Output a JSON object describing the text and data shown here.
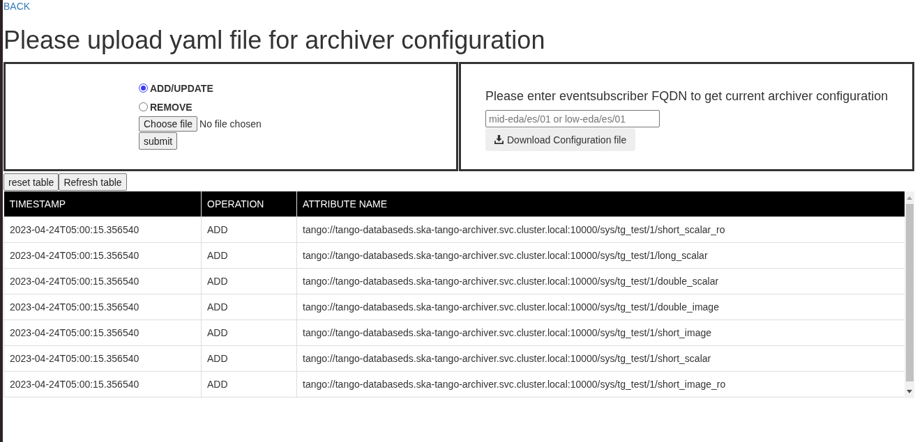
{
  "back_link": "BACK",
  "heading": "Please upload yaml file for archiver configuration",
  "upload_panel": {
    "operations": [
      {
        "label": "ADD/UPDATE",
        "selected": true
      },
      {
        "label": "REMOVE",
        "selected": false
      }
    ],
    "file_button": "Choose file",
    "file_status": "No file chosen",
    "submit_button": "submit"
  },
  "download_panel": {
    "prompt": "Please enter eventsubscriber FQDN to get current archiver configuration",
    "fqdn_field": {
      "placeholder": "mid-eda/es/01 or low-eda/es/01"
    },
    "download_button": "Download Configuration file"
  },
  "table_buttons": [
    "reset table",
    "Refresh table"
  ],
  "table": {
    "columns": [
      "TIMESTAMP",
      "OPERATION",
      "ATTRIBUTE NAME"
    ],
    "rows": [
      [
        "2023-04-24T05:00:15.356540",
        "ADD",
        "tango://tango-databaseds.ska-tango-archiver.svc.cluster.local:10000/sys/tg_test/1/short_scalar_ro"
      ],
      [
        "2023-04-24T05:00:15.356540",
        "ADD",
        "tango://tango-databaseds.ska-tango-archiver.svc.cluster.local:10000/sys/tg_test/1/long_scalar"
      ],
      [
        "2023-04-24T05:00:15.356540",
        "ADD",
        "tango://tango-databaseds.ska-tango-archiver.svc.cluster.local:10000/sys/tg_test/1/double_scalar"
      ],
      [
        "2023-04-24T05:00:15.356540",
        "ADD",
        "tango://tango-databaseds.ska-tango-archiver.svc.cluster.local:10000/sys/tg_test/1/double_image"
      ],
      [
        "2023-04-24T05:00:15.356540",
        "ADD",
        "tango://tango-databaseds.ska-tango-archiver.svc.cluster.local:10000/sys/tg_test/1/short_image"
      ],
      [
        "2023-04-24T05:00:15.356540",
        "ADD",
        "tango://tango-databaseds.ska-tango-archiver.svc.cluster.local:10000/sys/tg_test/1/short_scalar"
      ],
      [
        "2023-04-24T05:00:15.356540",
        "ADD",
        "tango://tango-databaseds.ska-tango-archiver.svc.cluster.local:10000/sys/tg_test/1/short_image_ro"
      ]
    ]
  }
}
